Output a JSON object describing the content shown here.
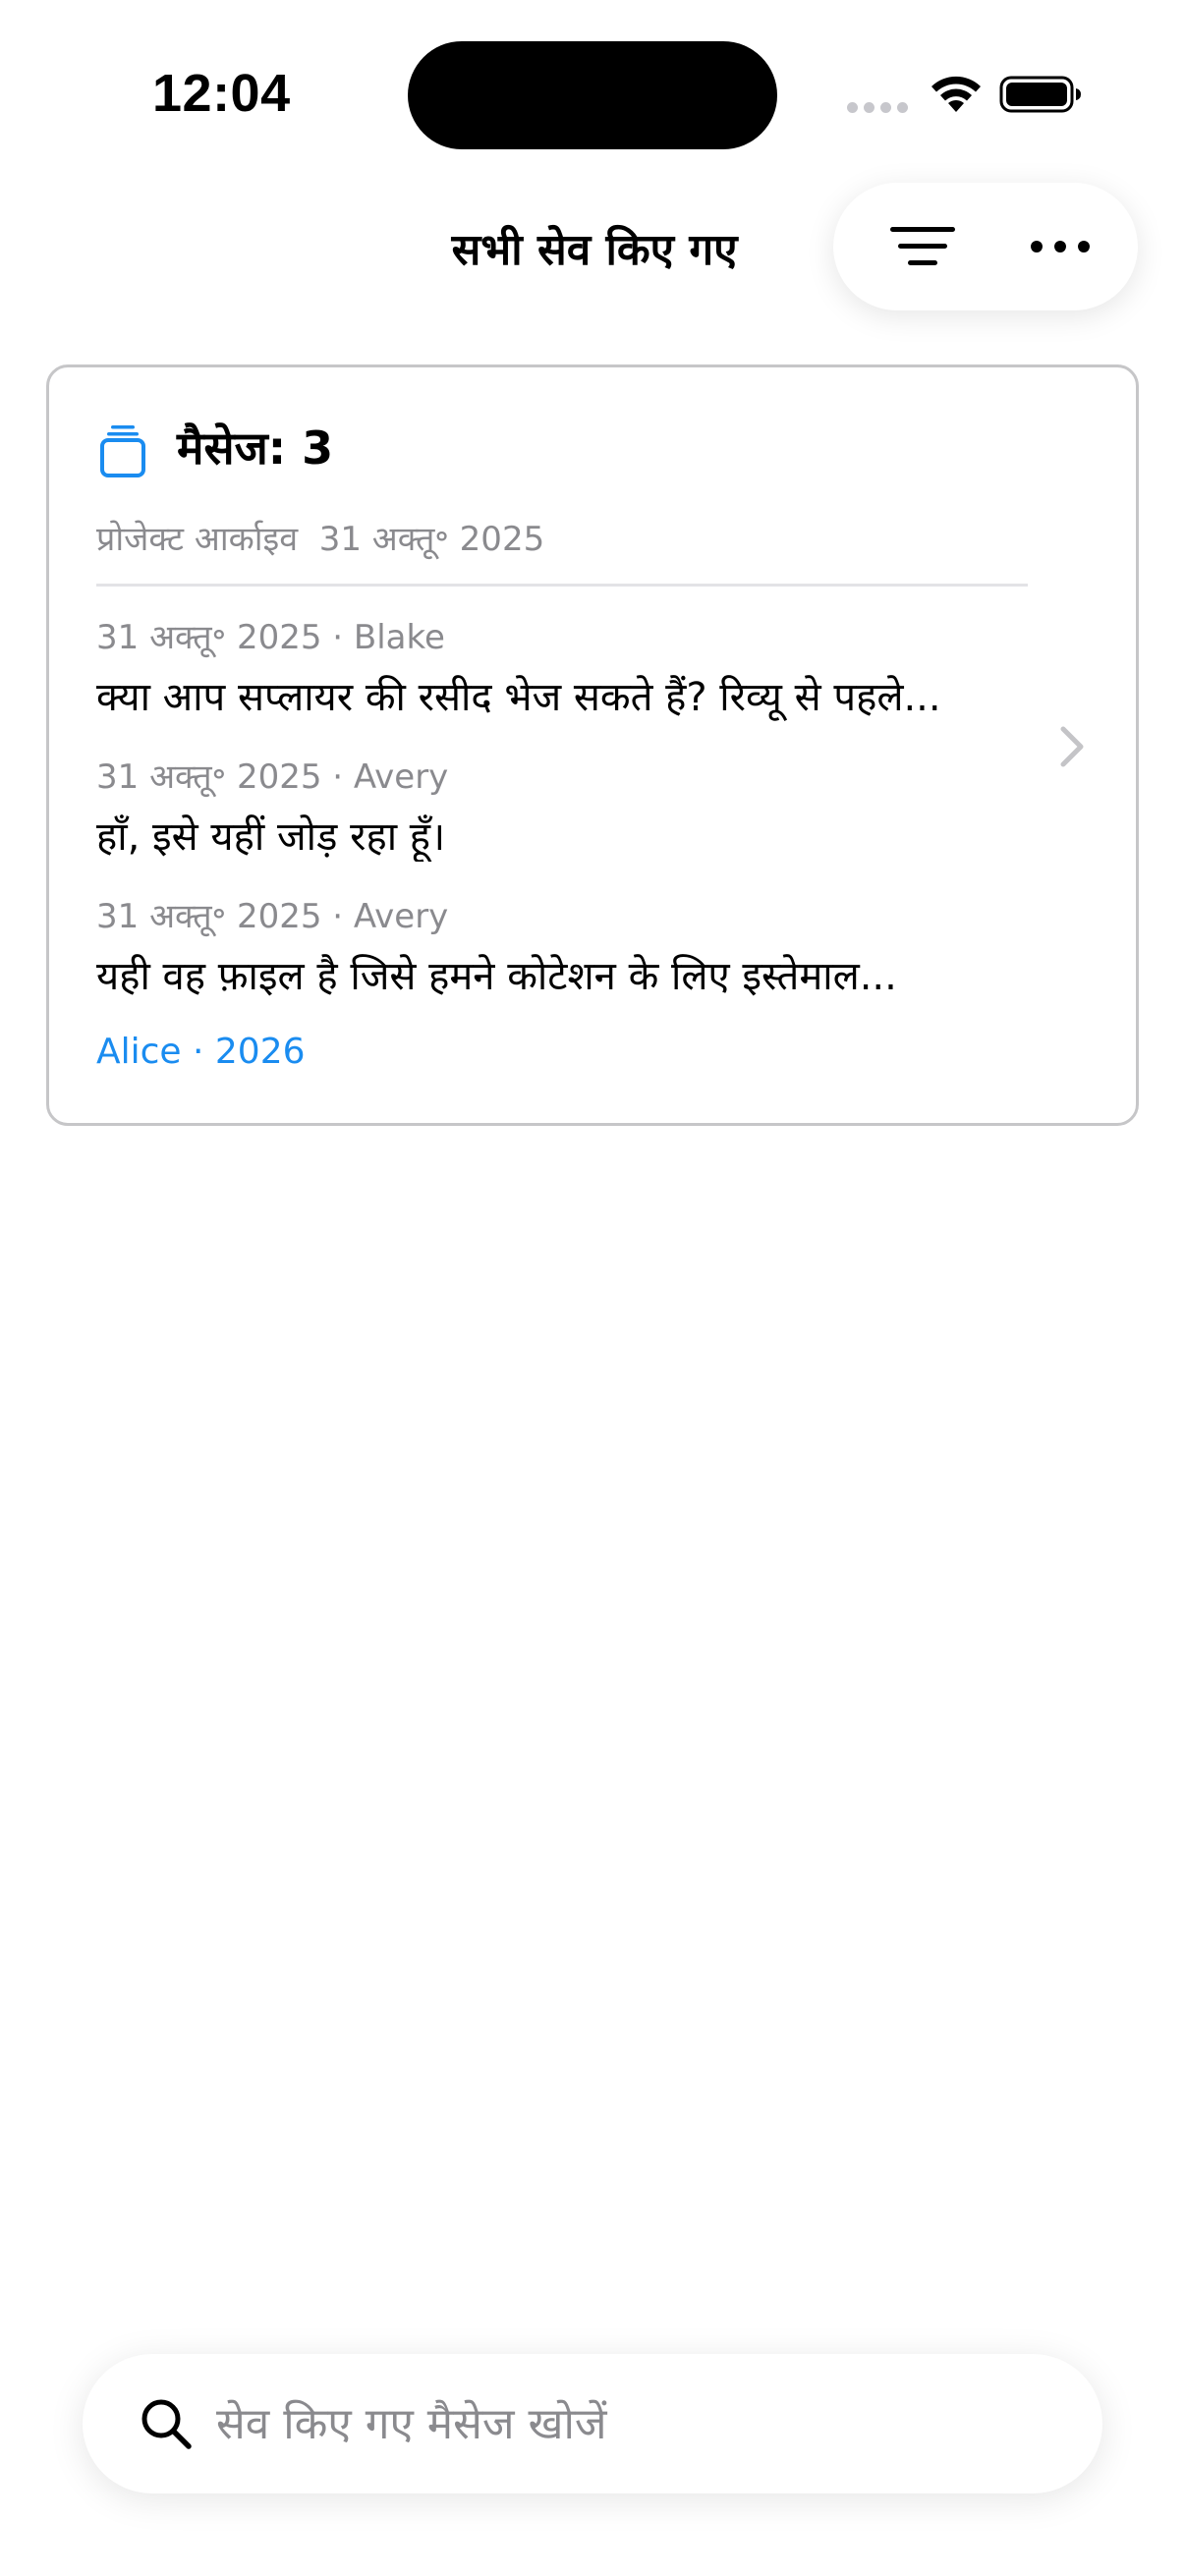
{
  "status_bar": {
    "time": "12:04"
  },
  "header": {
    "title": "सभी सेव किए गए",
    "filter_icon": "filter-lines-icon",
    "more_icon": "more-horizontal-icon"
  },
  "card": {
    "icon": "stack-icon",
    "title": "मैसेज: 3",
    "subtitle": "प्रोजेक्ट आर्काइव  31 अक्तू॰ 2025",
    "messages": [
      {
        "meta": "31 अक्तू॰ 2025 · Blake",
        "text": "क्या आप सप्लायर की रसीद भेज सकते हैं? रिव्यू से पहले..."
      },
      {
        "meta": "31 अक्तू॰ 2025 · Avery",
        "text": "हाँ, इसे यहीं जोड़ रहा हूँ।"
      },
      {
        "meta": "31 अक्तू॰ 2025 · Avery",
        "text": "यही वह फ़ाइल है जिसे हमने कोटेशन के लिए इस्तेमाल..."
      }
    ],
    "footer": "Alice · 2026",
    "chevron_icon": "chevron-right-icon"
  },
  "search": {
    "placeholder": "सेव किए गए मैसेज खोजें",
    "value": ""
  },
  "colors": {
    "accent": "#1a8cf0",
    "secondary_text": "#8a8a8e",
    "card_border": "#c6c6c8"
  }
}
